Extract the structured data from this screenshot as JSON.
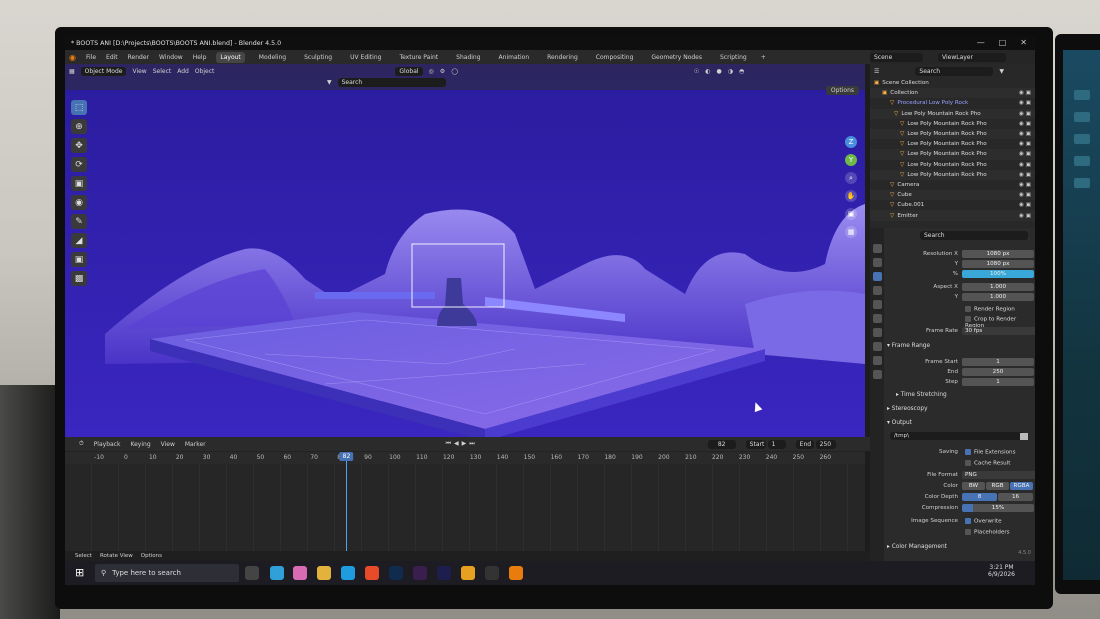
{
  "window": {
    "title": "* BOOTS ANI [D:\\Projects\\BOOTS\\BOOTS ANI.blend] - Blender 4.5.0"
  },
  "menu": [
    "File",
    "Edit",
    "Render",
    "Window",
    "Help"
  ],
  "workspace_tabs": [
    "Layout",
    "Modeling",
    "Sculpting",
    "UV Editing",
    "Texture Paint",
    "Shading",
    "Animation",
    "Rendering",
    "Compositing",
    "Geometry Nodes",
    "Scripting"
  ],
  "scene": {
    "name": "Scene",
    "view_layer": "ViewLayer"
  },
  "viewport": {
    "mode": "Object Mode",
    "menus": [
      "View",
      "Select",
      "Add",
      "Object"
    ],
    "orientation": "Global",
    "search_placeholder": "Search",
    "options_label": "Options"
  },
  "timeline": {
    "menus": [
      "Playback",
      "Keying",
      "View",
      "Marker"
    ],
    "current_frame": "82",
    "start_label": "Start",
    "start": "1",
    "end_label": "End",
    "end": "250",
    "ticks": [
      "-10",
      "0",
      "10",
      "20",
      "30",
      "40",
      "50",
      "60",
      "70",
      "80",
      "90",
      "100",
      "110",
      "120",
      "130",
      "140",
      "150",
      "160",
      "170",
      "180",
      "190",
      "200",
      "210",
      "220",
      "230",
      "240",
      "250",
      "260"
    ]
  },
  "statusbar": [
    "Select",
    "Rotate View",
    "Options"
  ],
  "outliner": {
    "search_placeholder": "Search",
    "items": [
      {
        "label": "Scene Collection"
      },
      {
        "label": "Collection"
      },
      {
        "label": "Procedural Low Poly Rock"
      },
      {
        "label": "Low Poly Mountain Rock Pho"
      },
      {
        "label": "Low Poly Mountain Rock Pho"
      },
      {
        "label": "Low Poly Mountain Rock Pho"
      },
      {
        "label": "Low Poly Mountain Rock Pho"
      },
      {
        "label": "Low Poly Mountain Rock Pho"
      },
      {
        "label": "Low Poly Mountain Rock Pho"
      },
      {
        "label": "Low Poly Mountain Rock Pho"
      },
      {
        "label": "Camera"
      },
      {
        "label": "Cube"
      },
      {
        "label": "Cube.001"
      },
      {
        "label": "Emitter"
      }
    ]
  },
  "properties": {
    "search_placeholder": "Search",
    "resolution_x": {
      "label": "Resolution X",
      "value": "1080 px"
    },
    "resolution_y": {
      "label": "Y",
      "value": "1080 px"
    },
    "resolution_pct": {
      "label": "%",
      "value": "100%"
    },
    "aspect_x": {
      "label": "Aspect X",
      "value": "1.000"
    },
    "aspect_y": {
      "label": "Y",
      "value": "1.000"
    },
    "render_region": "Render Region",
    "crop_region": "Crop to Render Region",
    "frame_rate": {
      "label": "Frame Rate",
      "value": "30 fps"
    },
    "frame_range_header": "Frame Range",
    "frame_start": {
      "label": "Frame Start",
      "value": "1"
    },
    "frame_end": {
      "label": "End",
      "value": "250"
    },
    "frame_step": {
      "label": "Step",
      "value": "1"
    },
    "time_stretching": "Time Stretching",
    "stereoscopy": "Stereoscopy",
    "output_header": "Output",
    "output_path": "/tmp\\",
    "saving_label": "Saving",
    "file_extensions": "File Extensions",
    "cache_result": "Cache Result",
    "file_format": {
      "label": "File Format",
      "value": "PNG"
    },
    "color": {
      "label": "Color",
      "options": [
        "BW",
        "RGB",
        "RGBA"
      ]
    },
    "color_depth": {
      "label": "Color Depth",
      "options": [
        "8",
        "16"
      ]
    },
    "compression": {
      "label": "Compression",
      "value": "15%"
    },
    "image_sequence_label": "Image Sequence",
    "overwrite": "Overwrite",
    "placeholders": "Placeholders",
    "color_management": "Color Management",
    "version": "4.5.0"
  },
  "taskbar": {
    "search_placeholder": "Type here to search",
    "time": "3:21 PM",
    "date": "6/9/2026"
  }
}
